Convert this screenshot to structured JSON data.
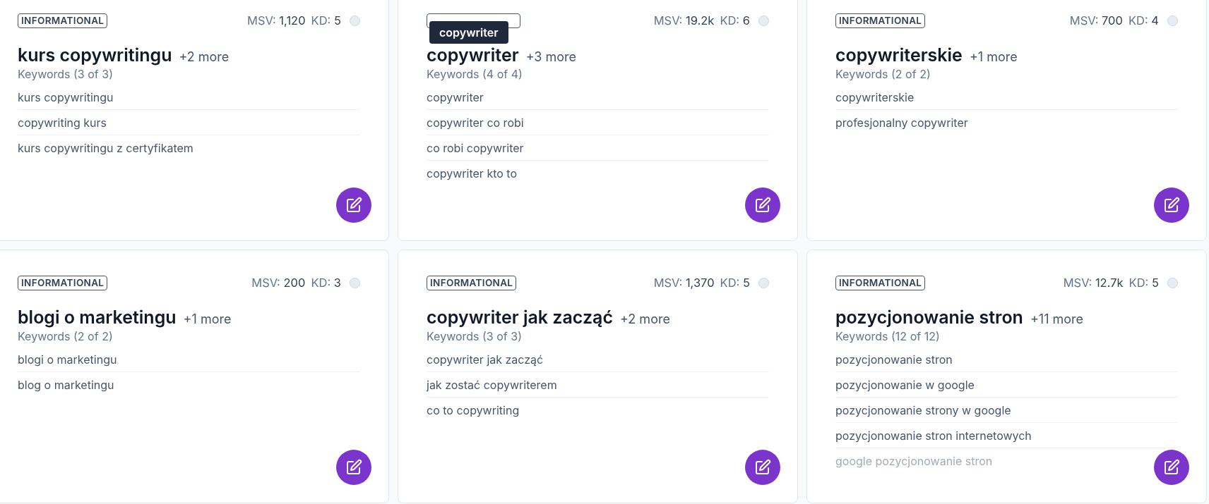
{
  "cards": [
    {
      "selected": false,
      "tag": "INFORMATIONAL",
      "msv_label": "MSV:",
      "msv": "1,120",
      "kd_label": "KD:",
      "kd": "5",
      "title": "kurs copywritingu",
      "more": "+2 more",
      "keywords_label": "Keywords (3 of 3)",
      "keywords": [
        {
          "text": "kurs copywritingu",
          "faded": false
        },
        {
          "text": "copywriting kurs",
          "faded": false
        },
        {
          "text": "kurs copywritingu z certyfikatem",
          "faded": false
        }
      ]
    },
    {
      "selected": false,
      "tooltip": "copywriter",
      "msv_label": "MSV:",
      "msv": "19.2k",
      "kd_label": "KD:",
      "kd": "6",
      "title": "copywriter",
      "more": "+3 more",
      "keywords_label": "Keywords (4 of 4)",
      "keywords": [
        {
          "text": "copywriter",
          "faded": false
        },
        {
          "text": "copywriter co robi",
          "faded": false
        },
        {
          "text": "co robi copywriter",
          "faded": false
        },
        {
          "text": "copywriter kto to",
          "faded": false
        }
      ]
    },
    {
      "selected": false,
      "tag": "INFORMATIONAL",
      "msv_label": "MSV:",
      "msv": "700",
      "kd_label": "KD:",
      "kd": "4",
      "title": "copywriterskie",
      "more": "+1 more",
      "keywords_label": "Keywords (2 of 2)",
      "keywords": [
        {
          "text": "copywriterskie",
          "faded": false
        },
        {
          "text": "profesjonalny copywriter",
          "faded": false
        }
      ]
    },
    {
      "selected": false,
      "tag": "INFORMATIONAL",
      "msv_label": "MSV:",
      "msv": "200",
      "kd_label": "KD:",
      "kd": "3",
      "title": "blogi o marketingu",
      "more": "+1 more",
      "keywords_label": "Keywords (2 of 2)",
      "keywords": [
        {
          "text": "blogi o marketingu",
          "faded": false
        },
        {
          "text": "blog o marketingu",
          "faded": false
        }
      ]
    },
    {
      "selected": false,
      "tag": "INFORMATIONAL",
      "msv_label": "MSV:",
      "msv": "1,370",
      "kd_label": "KD:",
      "kd": "5",
      "title": "copywriter jak zacząć",
      "more": "+2 more",
      "keywords_label": "Keywords (3 of 3)",
      "keywords": [
        {
          "text": "copywriter jak zacząć",
          "faded": false
        },
        {
          "text": "jak zostać copywriterem",
          "faded": false
        },
        {
          "text": "co to copywriting",
          "faded": false
        }
      ]
    },
    {
      "selected": false,
      "tag": "INFORMATIONAL",
      "msv_label": "MSV:",
      "msv": "12.7k",
      "kd_label": "KD:",
      "kd": "5",
      "title": "pozycjonowanie stron",
      "more": "+11 more",
      "keywords_label": "Keywords (12 of 12)",
      "keywords": [
        {
          "text": "pozycjonowanie stron",
          "faded": false
        },
        {
          "text": "pozycjonowanie w google",
          "faded": false
        },
        {
          "text": "pozycjonowanie strony w google",
          "faded": false
        },
        {
          "text": "pozycjonowanie stron internetowych",
          "faded": false
        },
        {
          "text": "google pozycjonowanie stron",
          "faded": true
        }
      ]
    }
  ]
}
